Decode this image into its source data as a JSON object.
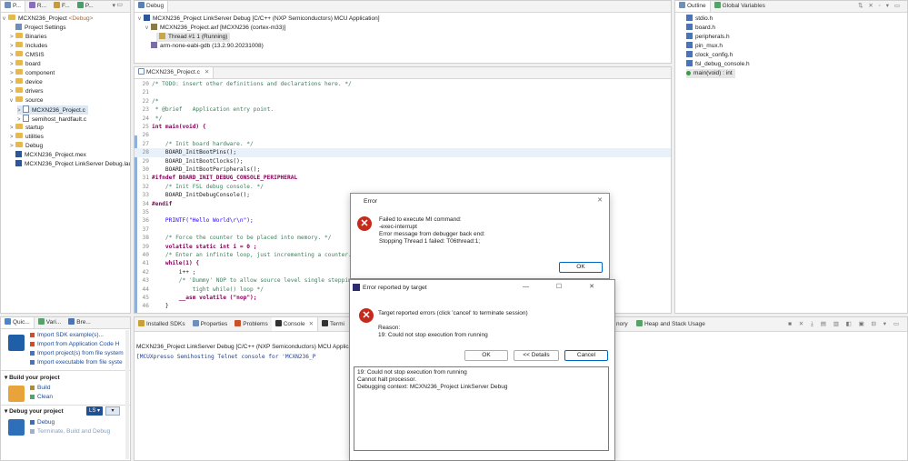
{
  "project_explorer": {
    "tabs": [
      "P...",
      "R...",
      "F...",
      "P..."
    ],
    "items": [
      {
        "label": "MCXN236_Project",
        "suffix": " <Debug>",
        "kind": "project"
      },
      {
        "label": "Project Settings",
        "kind": "settings"
      },
      {
        "label": "Binaries",
        "kind": "folder"
      },
      {
        "label": "Includes",
        "kind": "folder"
      },
      {
        "label": "CMSIS",
        "kind": "folder"
      },
      {
        "label": "board",
        "kind": "folder"
      },
      {
        "label": "component",
        "kind": "folder"
      },
      {
        "label": "device",
        "kind": "folder"
      },
      {
        "label": "drivers",
        "kind": "folder"
      },
      {
        "label": "source",
        "kind": "folder"
      },
      {
        "label": "MCXN236_Project.c",
        "kind": "cfile"
      },
      {
        "label": "semihost_hardfault.c",
        "kind": "cfile"
      },
      {
        "label": "startup",
        "kind": "folder"
      },
      {
        "label": "utilities",
        "kind": "folder"
      },
      {
        "label": "Debug",
        "kind": "folder"
      },
      {
        "label": "MCXN236_Project.mex",
        "kind": "file"
      },
      {
        "label": "MCXN236_Project LinkServer Debug.lau",
        "kind": "file"
      }
    ]
  },
  "debug_view": {
    "tab": "Debug",
    "items": [
      "MCXN236_Project LinkServer Debug [C/C++ (NXP Semiconductors) MCU Application]",
      "MCXN236_Project.axf [MCXN236 (cortex-m33)]",
      "Thread #1 1 (Running)",
      "arm-none-eabi-gdb (13.2.90.20231008)"
    ]
  },
  "outline": {
    "tabs": [
      "Outline",
      "Global Variables"
    ],
    "items": [
      "stdio.h",
      "board.h",
      "peripherals.h",
      "pin_mux.h",
      "clock_config.h",
      "fsl_debug_console.h",
      "main(void) : int"
    ]
  },
  "editor": {
    "tab": "MCXN236_Project.c",
    "lines": [
      {
        "n": "20",
        "t": "/* TODO: insert other definitions and declarations here. */",
        "c": "cm"
      },
      {
        "n": "21",
        "t": "",
        "c": ""
      },
      {
        "n": "22",
        "t": "/*",
        "c": "cm"
      },
      {
        "n": "23",
        "t": " * @brief   Application entry point.",
        "c": "cm"
      },
      {
        "n": "24",
        "t": " */",
        "c": "cm"
      },
      {
        "n": "25",
        "t": "int main(void) {",
        "c": "kw"
      },
      {
        "n": "26",
        "t": "",
        "c": ""
      },
      {
        "n": "27",
        "t": "    /* Init board hardware. */",
        "c": "cm"
      },
      {
        "n": "28",
        "t": "    BOARD_InitBootPins();",
        "c": ""
      },
      {
        "n": "29",
        "t": "    BOARD_InitBootClocks();",
        "c": ""
      },
      {
        "n": "30",
        "t": "    BOARD_InitBootPeripherals();",
        "c": ""
      },
      {
        "n": "31",
        "t": "#ifndef BOARD_INIT_DEBUG_CONSOLE_PERIPHERAL",
        "c": "pp"
      },
      {
        "n": "32",
        "t": "    /* Init FSL debug console. */",
        "c": "cm"
      },
      {
        "n": "33",
        "t": "    BOARD_InitDebugConsole();",
        "c": ""
      },
      {
        "n": "34",
        "t": "#endif",
        "c": "pp"
      },
      {
        "n": "35",
        "t": "",
        "c": ""
      },
      {
        "n": "36",
        "t": "    PRINTF(\"Hello World\\r\\n\");",
        "c": "str"
      },
      {
        "n": "37",
        "t": "",
        "c": ""
      },
      {
        "n": "38",
        "t": "    /* Force the counter to be placed into memory. */",
        "c": "cm"
      },
      {
        "n": "39",
        "t": "    volatile static int i = 0 ;",
        "c": "kw"
      },
      {
        "n": "40",
        "t": "    /* Enter an infinite loop, just incrementing a counter. */",
        "c": "cm"
      },
      {
        "n": "41",
        "t": "    while(1) {",
        "c": "kw"
      },
      {
        "n": "42",
        "t": "        i++ ;",
        "c": ""
      },
      {
        "n": "43",
        "t": "        /* 'Dummy' NOP to allow source level single stepping of",
        "c": "cm"
      },
      {
        "n": "44",
        "t": "            tight while() loop */",
        "c": "cm"
      },
      {
        "n": "45",
        "t": "        __asm volatile (\"nop\");",
        "c": "kw"
      },
      {
        "n": "46",
        "t": "    }",
        "c": ""
      }
    ]
  },
  "quickstart": {
    "tabs": [
      "Quic...",
      "Vari...",
      "Bre..."
    ],
    "links_top": [
      "Import SDK example(s)...",
      "Import from Application Code H",
      "Import project(s) from file system",
      "Import executable from file syste"
    ],
    "build_header": "Build your project",
    "build_links": [
      "Build",
      "Clean"
    ],
    "debug_header": "Debug your project",
    "debug_links": [
      "Debug",
      "Terminate, Build and Debug"
    ],
    "debug_badge": "LS"
  },
  "console": {
    "tabs": [
      "Installed SDKs",
      "Properties",
      "Problems",
      "Console",
      "Termi",
      "nory",
      "Heap and Stack Usage"
    ],
    "title": "MCXN236_Project LinkServer Debug [C/C++ (NXP Semiconductors) MCU Applica",
    "line": "[MCUXpresso Semihosting Telnet console for 'MCXN236_P"
  },
  "error_dialog": {
    "title": "Error",
    "message": [
      "Failed to execute MI command:",
      "-exec-interrupt",
      "Error message from debugger back end:",
      "Stopping Thread 1 failed: T06thread:1;"
    ],
    "ok": "OK"
  },
  "target_dialog": {
    "title": "Error reported by target",
    "message": "Target reported errors (click 'cancel' to terminate session)",
    "reason_label": "Reason:",
    "reason": "19: Could not stop execution from running",
    "ok": "OK",
    "details": "<< Details",
    "cancel": "Cancel",
    "details_text": [
      "19: Could not stop execution from running",
      "Cannot halt processor.",
      "Debugging context: MCXN236_Project LinkServer Debug"
    ]
  },
  "colors": {
    "accent": "#0067c0",
    "error": "#c42b1c",
    "selection": "#dde8f5"
  }
}
